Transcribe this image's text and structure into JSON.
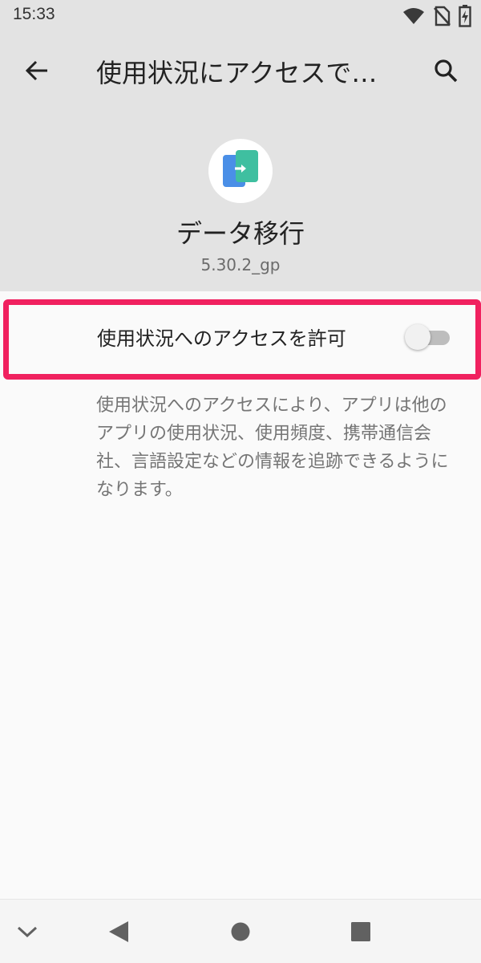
{
  "status_bar": {
    "time": "15:33",
    "icons": [
      "wifi-icon",
      "no-sim-icon",
      "battery-charging-icon"
    ]
  },
  "toolbar": {
    "back_icon": "arrow-back-icon",
    "title": "使用状況にアクセスで…",
    "search_icon": "search-icon"
  },
  "app": {
    "name": "データ移行",
    "version": "5.30.2_gp",
    "icon": "data-transfer-app-icon"
  },
  "permission": {
    "label": "使用状況へのアクセスを許可",
    "enabled": false
  },
  "description": "使用状況へのアクセスにより、アプリは他のアプリの使用状況、使用頻度、携帯通信会社、言語設定などの情報を追跡できるようになります。",
  "nav_bar": {
    "buttons": [
      "collapse-chevron-icon",
      "back-triangle-icon",
      "home-circle-icon",
      "recents-square-icon"
    ]
  },
  "colors": {
    "header_bg": "#e3e3e3",
    "highlight": "#f0215f",
    "app_icon_blue": "#4a8fe7",
    "app_icon_green": "#3fbfa0"
  }
}
